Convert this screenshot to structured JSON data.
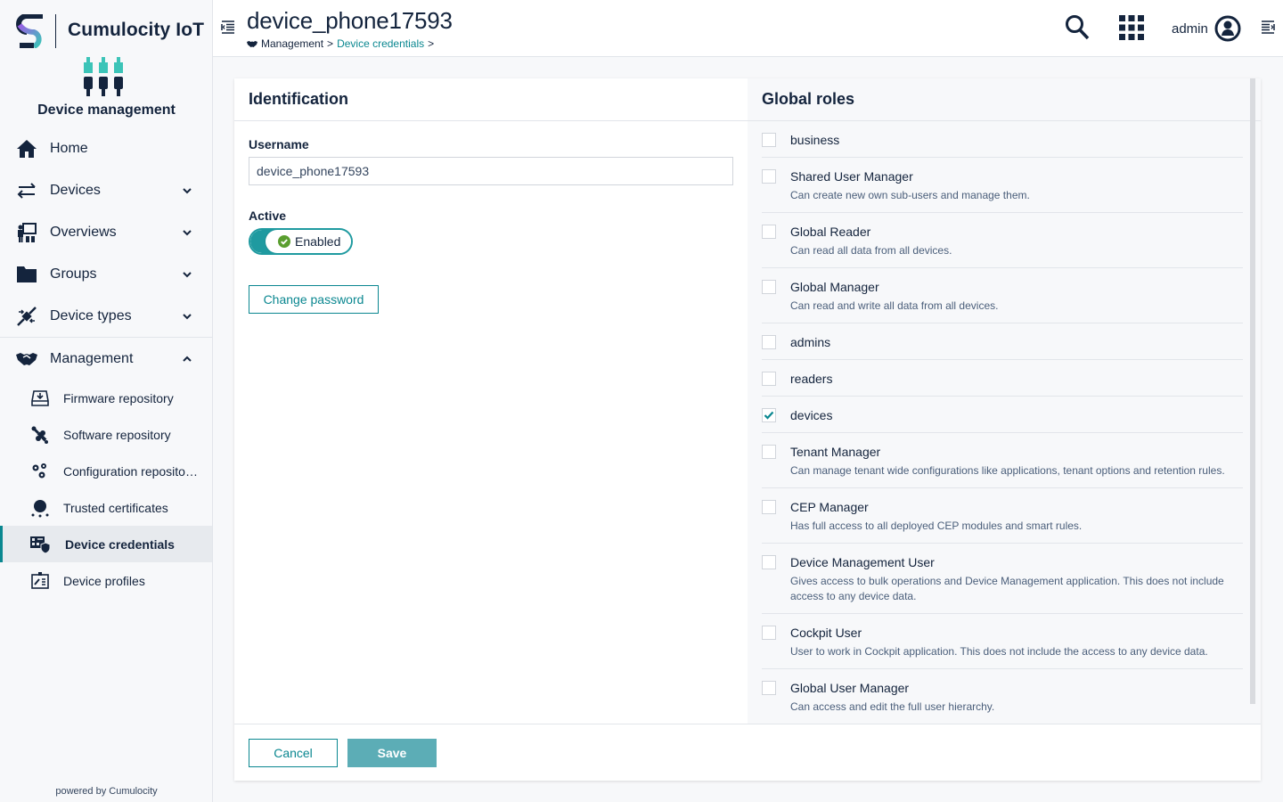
{
  "brand": {
    "name": "Cumulocity IoT",
    "app_name": "Device management"
  },
  "sidebar": {
    "items": [
      {
        "label": "Home",
        "icon": "home-icon",
        "expandable": false
      },
      {
        "label": "Devices",
        "icon": "exchange-arrows-icon",
        "expandable": true,
        "expanded": false
      },
      {
        "label": "Overviews",
        "icon": "presentation-icon",
        "expandable": true,
        "expanded": false
      },
      {
        "label": "Groups",
        "icon": "folder-icon",
        "expandable": true,
        "expanded": false
      },
      {
        "label": "Device types",
        "icon": "plug-icon",
        "expandable": true,
        "expanded": false
      },
      {
        "label": "Management",
        "icon": "handshake-icon",
        "expandable": true,
        "expanded": true
      }
    ],
    "management_items": [
      {
        "label": "Firmware repository",
        "icon": "firmware-icon",
        "active": false
      },
      {
        "label": "Software repository",
        "icon": "software-icon",
        "active": false
      },
      {
        "label": "Configuration reposito…",
        "icon": "config-gears-icon",
        "active": false
      },
      {
        "label": "Trusted certificates",
        "icon": "certificate-icon",
        "active": false
      },
      {
        "label": "Device credentials",
        "icon": "device-credentials-icon",
        "active": true
      },
      {
        "label": "Device profiles",
        "icon": "device-profile-icon",
        "active": false
      }
    ],
    "powered_by": "powered by Cumulocity"
  },
  "header": {
    "title": "device_phone17593",
    "breadcrumb": [
      {
        "label": "Management",
        "link": false
      },
      {
        "label": "Device credentials",
        "link": true
      }
    ],
    "separator": ">",
    "user": "admin"
  },
  "identification": {
    "heading": "Identification",
    "username_label": "Username",
    "username_value": "device_phone17593",
    "active_label": "Active",
    "active_state": "Enabled",
    "active": true,
    "change_password_label": "Change password"
  },
  "global_roles": {
    "heading": "Global roles",
    "roles": [
      {
        "name": "business",
        "description": "",
        "checked": false
      },
      {
        "name": "Shared User Manager",
        "description": "Can create new own sub-users and manage them.",
        "checked": false
      },
      {
        "name": "Global Reader",
        "description": "Can read all data from all devices.",
        "checked": false
      },
      {
        "name": "Global Manager",
        "description": "Can read and write all data from all devices.",
        "checked": false
      },
      {
        "name": "admins",
        "description": "",
        "checked": false
      },
      {
        "name": "readers",
        "description": "",
        "checked": false
      },
      {
        "name": "devices",
        "description": "",
        "checked": true
      },
      {
        "name": "Tenant Manager",
        "description": "Can manage tenant wide configurations like applications, tenant options and retention rules.",
        "checked": false
      },
      {
        "name": "CEP Manager",
        "description": "Has full access to all deployed CEP modules and smart rules.",
        "checked": false
      },
      {
        "name": "Device Management User",
        "description": "Gives access to bulk operations and Device Management application. This does not include access to any device data.",
        "checked": false
      },
      {
        "name": "Cockpit User",
        "description": "User to work in Cockpit application. This does not include the access to any device data.",
        "checked": false
      },
      {
        "name": "Global User Manager",
        "description": "Can access and edit the full user hierarchy.",
        "checked": false
      }
    ]
  },
  "footer": {
    "cancel_label": "Cancel",
    "save_label": "Save"
  },
  "colors": {
    "accent": "#0a8790",
    "toggle": "#1f9aa0",
    "save_button": "#5cadb6",
    "text": "#14243d",
    "check_green": "#5a9e2f",
    "logo_teal": "#3cc4b8"
  }
}
